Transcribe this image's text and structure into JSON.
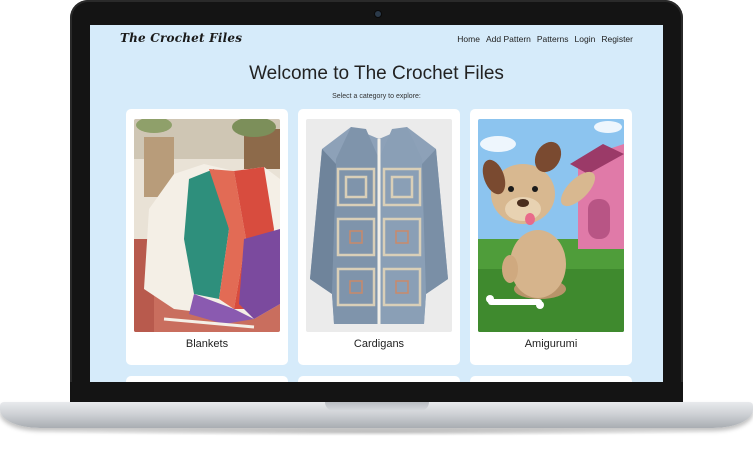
{
  "site": {
    "brand": "The Crochet Files",
    "nav": [
      "Home",
      "Add Pattern",
      "Patterns",
      "Login",
      "Register"
    ]
  },
  "hero": {
    "title": "Welcome to The Crochet Files",
    "subtitle": "Select a category to explore:"
  },
  "categories": [
    {
      "label": "Blankets"
    },
    {
      "label": "Cardigans"
    },
    {
      "label": "Amigurumi"
    }
  ],
  "colors": {
    "page_bg": "#d6ebfa",
    "card_bg": "#ffffff",
    "device_frame": "#141414"
  }
}
